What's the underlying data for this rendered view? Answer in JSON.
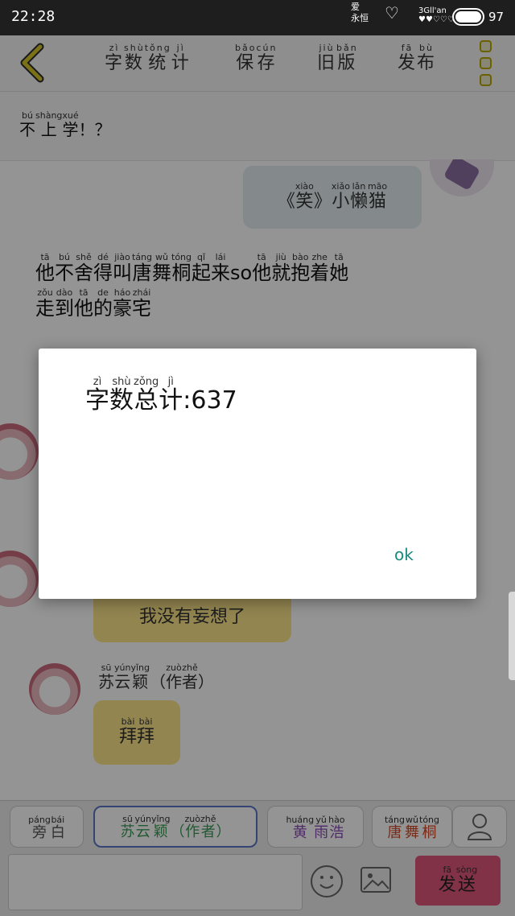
{
  "status_bar": {
    "time": "22:28",
    "deco_line1": "爱",
    "deco_line2": "永恒",
    "network_label": "3G",
    "network_sub": "ll'an",
    "battery_level": "97"
  },
  "toolbar": {
    "word_count": {
      "text": [
        "字",
        "数",
        "统",
        "计"
      ],
      "pinyin": [
        "zì",
        "shù",
        "tǒng",
        "jì"
      ]
    },
    "save": {
      "text": [
        "保",
        "存"
      ],
      "pinyin": [
        "bǎo",
        "cún"
      ]
    },
    "old_version": {
      "text": [
        "旧",
        "版"
      ],
      "pinyin": [
        "jiù",
        "bǎn"
      ]
    },
    "publish": {
      "text": [
        "发",
        "布"
      ],
      "pinyin": [
        "fā",
        "bù"
      ]
    }
  },
  "chat": {
    "topic": {
      "text": [
        "不",
        "上",
        "学",
        "！",
        "？"
      ],
      "pinyin": [
        "bú",
        "shàng",
        "xué",
        "",
        ""
      ]
    },
    "blue_bubble": {
      "text": [
        "《",
        "笑",
        "》",
        "小",
        "懒",
        "猫"
      ],
      "pinyin": [
        "",
        "xiào",
        "",
        "xiǎo",
        "lǎn",
        "māo"
      ]
    },
    "narration_line1": {
      "text": [
        "他",
        "不",
        "舍",
        "得",
        "叫",
        "唐",
        "舞",
        "桐",
        "起",
        "来",
        "so",
        "他",
        "就",
        "抱",
        "着",
        "她"
      ],
      "pinyin": [
        "tā",
        "bú",
        "shě",
        "dé",
        "jiào",
        "táng",
        "wǔ",
        "tóng",
        "qǐ",
        "lái",
        "",
        "tā",
        "jiù",
        "bào",
        "zhe",
        "tā"
      ]
    },
    "narration_line2": {
      "text": [
        "走",
        "到",
        "他",
        "的",
        "豪",
        "宅"
      ],
      "pinyin": [
        "zǒu",
        "dào",
        "tā",
        "de",
        "háo",
        "zhái"
      ]
    },
    "yellow_bubble_1": {
      "text": [
        "我",
        "没",
        "有",
        "妄",
        "想",
        "了"
      ],
      "pinyin": [
        "",
        "",
        "",
        "",
        "",
        ""
      ]
    },
    "speaker": {
      "text": [
        "苏",
        "云",
        "颖",
        "（",
        "作",
        "者",
        "）"
      ],
      "pinyin": [
        "sū",
        "yún",
        "yǐng",
        "",
        "zuò",
        "zhě",
        ""
      ]
    },
    "yellow_bubble_2": {
      "text": [
        "拜",
        "拜"
      ],
      "pinyin": [
        "bài",
        "bài"
      ]
    }
  },
  "dialog": {
    "message": {
      "text": [
        "字",
        "数",
        "总",
        "计",
        ":637"
      ],
      "pinyin": [
        "zì",
        "shù",
        "zǒng",
        "jì",
        ""
      ]
    },
    "ok_label": "ok"
  },
  "bottom_bar": {
    "roles": [
      {
        "text": [
          "旁",
          "白"
        ],
        "pinyin": [
          "páng",
          "bái"
        ]
      },
      {
        "text": [
          "苏",
          "云",
          "颖",
          "（",
          "作",
          "者",
          "）"
        ],
        "pinyin": [
          "sū",
          "yún",
          "yǐng",
          "",
          "zuò",
          "zhě",
          ""
        ]
      },
      {
        "text": [
          "黄",
          "雨",
          "浩"
        ],
        "pinyin": [
          "huáng",
          "yǔ",
          "hào"
        ]
      },
      {
        "text": [
          "唐",
          "舞",
          "桐"
        ],
        "pinyin": [
          "táng",
          "wǔ",
          "tóng"
        ]
      }
    ],
    "send": {
      "text": [
        "发",
        "送"
      ],
      "pinyin": [
        "fā",
        "sòng"
      ]
    }
  },
  "colors": {
    "accent_ok": "#1a8a80",
    "send_button": "#e0577a",
    "bubble_yellow": "#fbe68a",
    "bubble_blue": "#e4eef2",
    "selected_role_border": "#5a78c8"
  },
  "icons": [
    "back-arrow-icon",
    "menu-icon",
    "emoji-icon",
    "image-icon",
    "person-icon",
    "heart-icon",
    "battery-icon"
  ]
}
